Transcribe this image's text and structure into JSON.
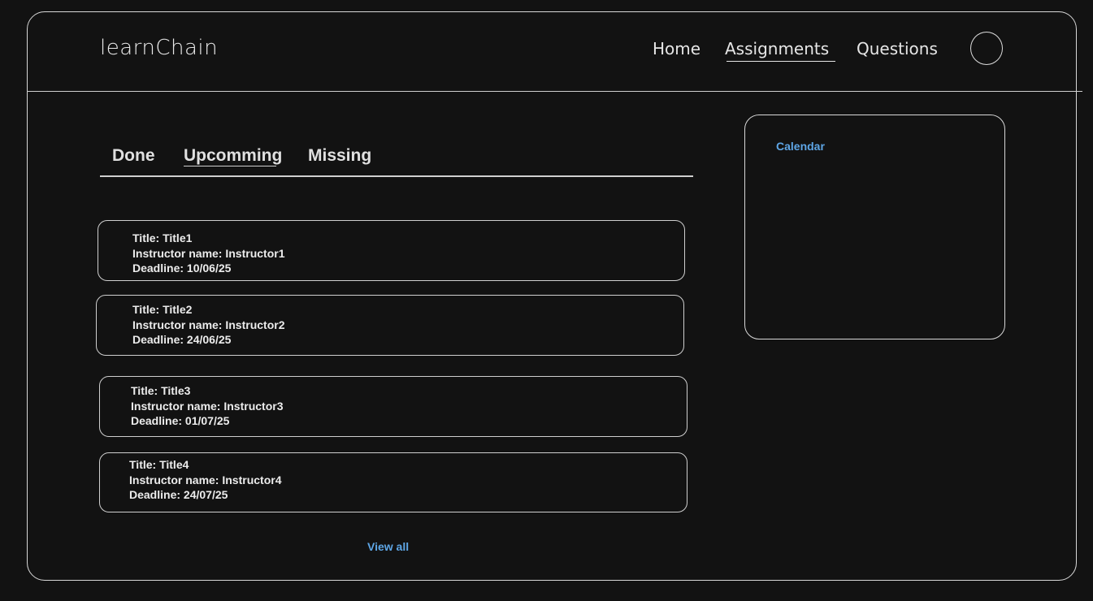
{
  "header": {
    "logo": "learnChain",
    "nav": {
      "home": "Home",
      "assignments": "Assignments",
      "questions": "Questions"
    },
    "active_nav": "Assignments"
  },
  "tabs": {
    "done": "Done",
    "upcoming": "Upcomming",
    "missing": "Missing",
    "active": "Upcomming"
  },
  "assignments": [
    {
      "title": "Title: Title1",
      "instructor": "Instructor name: Instructor1",
      "deadline": "Deadline: 10/06/25"
    },
    {
      "title": "Title: Title2",
      "instructor": "Instructor name: Instructor2",
      "deadline": "Deadline: 24/06/25"
    },
    {
      "title": "Title: Title3",
      "instructor": "Instructor name: Instructor3",
      "deadline": "Deadline: 01/07/25"
    },
    {
      "title": "Title: Title4",
      "instructor": "Instructor name: Instructor4",
      "deadline": "Deadline: 24/07/25"
    }
  ],
  "view_all": "View all",
  "calendar": {
    "label": "Calendar"
  },
  "colors": {
    "background": "#121212",
    "foreground": "#e6e6e6",
    "link": "#5ea6e6"
  }
}
